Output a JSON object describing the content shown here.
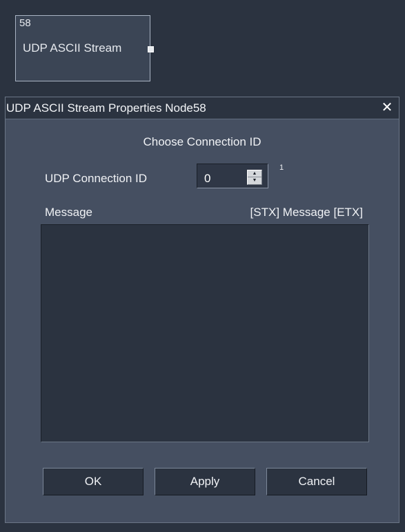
{
  "node": {
    "id": "58",
    "title": "UDP ASCII Stream"
  },
  "dialog": {
    "title": "UDP ASCII Stream Properties Node58",
    "close_glyph": "✕",
    "heading": "Choose Connection ID",
    "udp_connection": {
      "label": "UDP Connection ID",
      "value": "0",
      "note": "1"
    },
    "message": {
      "label": "Message",
      "hint": "[STX] Message [ETX]",
      "value": ""
    },
    "buttons": {
      "ok": "OK",
      "apply": "Apply",
      "cancel": "Cancel"
    }
  },
  "icons": {
    "close": "close-icon",
    "spin_up": "arrow-up-icon",
    "spin_down": "arrow-down-icon"
  },
  "colors": {
    "canvas_bg": "#2b3340",
    "dialog_bg": "#454f61",
    "text": "#f0f2f5"
  }
}
